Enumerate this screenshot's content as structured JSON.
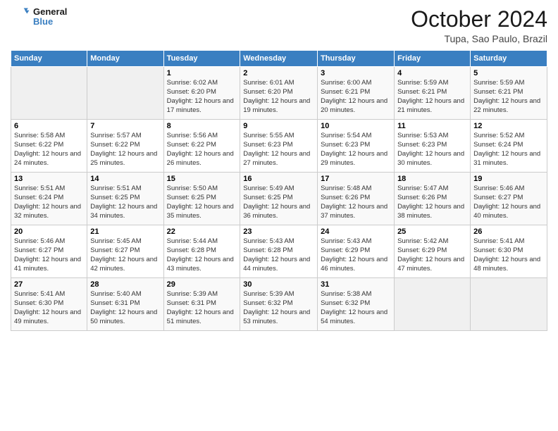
{
  "header": {
    "logo_line1": "General",
    "logo_line2": "Blue",
    "title": "October 2024",
    "subtitle": "Tupa, Sao Paulo, Brazil"
  },
  "days_of_week": [
    "Sunday",
    "Monday",
    "Tuesday",
    "Wednesday",
    "Thursday",
    "Friday",
    "Saturday"
  ],
  "weeks": [
    [
      {
        "num": "",
        "info": ""
      },
      {
        "num": "",
        "info": ""
      },
      {
        "num": "1",
        "info": "Sunrise: 6:02 AM\nSunset: 6:20 PM\nDaylight: 12 hours and 17 minutes."
      },
      {
        "num": "2",
        "info": "Sunrise: 6:01 AM\nSunset: 6:20 PM\nDaylight: 12 hours and 19 minutes."
      },
      {
        "num": "3",
        "info": "Sunrise: 6:00 AM\nSunset: 6:21 PM\nDaylight: 12 hours and 20 minutes."
      },
      {
        "num": "4",
        "info": "Sunrise: 5:59 AM\nSunset: 6:21 PM\nDaylight: 12 hours and 21 minutes."
      },
      {
        "num": "5",
        "info": "Sunrise: 5:59 AM\nSunset: 6:21 PM\nDaylight: 12 hours and 22 minutes."
      }
    ],
    [
      {
        "num": "6",
        "info": "Sunrise: 5:58 AM\nSunset: 6:22 PM\nDaylight: 12 hours and 24 minutes."
      },
      {
        "num": "7",
        "info": "Sunrise: 5:57 AM\nSunset: 6:22 PM\nDaylight: 12 hours and 25 minutes."
      },
      {
        "num": "8",
        "info": "Sunrise: 5:56 AM\nSunset: 6:22 PM\nDaylight: 12 hours and 26 minutes."
      },
      {
        "num": "9",
        "info": "Sunrise: 5:55 AM\nSunset: 6:23 PM\nDaylight: 12 hours and 27 minutes."
      },
      {
        "num": "10",
        "info": "Sunrise: 5:54 AM\nSunset: 6:23 PM\nDaylight: 12 hours and 29 minutes."
      },
      {
        "num": "11",
        "info": "Sunrise: 5:53 AM\nSunset: 6:23 PM\nDaylight: 12 hours and 30 minutes."
      },
      {
        "num": "12",
        "info": "Sunrise: 5:52 AM\nSunset: 6:24 PM\nDaylight: 12 hours and 31 minutes."
      }
    ],
    [
      {
        "num": "13",
        "info": "Sunrise: 5:51 AM\nSunset: 6:24 PM\nDaylight: 12 hours and 32 minutes."
      },
      {
        "num": "14",
        "info": "Sunrise: 5:51 AM\nSunset: 6:25 PM\nDaylight: 12 hours and 34 minutes."
      },
      {
        "num": "15",
        "info": "Sunrise: 5:50 AM\nSunset: 6:25 PM\nDaylight: 12 hours and 35 minutes."
      },
      {
        "num": "16",
        "info": "Sunrise: 5:49 AM\nSunset: 6:25 PM\nDaylight: 12 hours and 36 minutes."
      },
      {
        "num": "17",
        "info": "Sunrise: 5:48 AM\nSunset: 6:26 PM\nDaylight: 12 hours and 37 minutes."
      },
      {
        "num": "18",
        "info": "Sunrise: 5:47 AM\nSunset: 6:26 PM\nDaylight: 12 hours and 38 minutes."
      },
      {
        "num": "19",
        "info": "Sunrise: 5:46 AM\nSunset: 6:27 PM\nDaylight: 12 hours and 40 minutes."
      }
    ],
    [
      {
        "num": "20",
        "info": "Sunrise: 5:46 AM\nSunset: 6:27 PM\nDaylight: 12 hours and 41 minutes."
      },
      {
        "num": "21",
        "info": "Sunrise: 5:45 AM\nSunset: 6:27 PM\nDaylight: 12 hours and 42 minutes."
      },
      {
        "num": "22",
        "info": "Sunrise: 5:44 AM\nSunset: 6:28 PM\nDaylight: 12 hours and 43 minutes."
      },
      {
        "num": "23",
        "info": "Sunrise: 5:43 AM\nSunset: 6:28 PM\nDaylight: 12 hours and 44 minutes."
      },
      {
        "num": "24",
        "info": "Sunrise: 5:43 AM\nSunset: 6:29 PM\nDaylight: 12 hours and 46 minutes."
      },
      {
        "num": "25",
        "info": "Sunrise: 5:42 AM\nSunset: 6:29 PM\nDaylight: 12 hours and 47 minutes."
      },
      {
        "num": "26",
        "info": "Sunrise: 5:41 AM\nSunset: 6:30 PM\nDaylight: 12 hours and 48 minutes."
      }
    ],
    [
      {
        "num": "27",
        "info": "Sunrise: 5:41 AM\nSunset: 6:30 PM\nDaylight: 12 hours and 49 minutes."
      },
      {
        "num": "28",
        "info": "Sunrise: 5:40 AM\nSunset: 6:31 PM\nDaylight: 12 hours and 50 minutes."
      },
      {
        "num": "29",
        "info": "Sunrise: 5:39 AM\nSunset: 6:31 PM\nDaylight: 12 hours and 51 minutes."
      },
      {
        "num": "30",
        "info": "Sunrise: 5:39 AM\nSunset: 6:32 PM\nDaylight: 12 hours and 53 minutes."
      },
      {
        "num": "31",
        "info": "Sunrise: 5:38 AM\nSunset: 6:32 PM\nDaylight: 12 hours and 54 minutes."
      },
      {
        "num": "",
        "info": ""
      },
      {
        "num": "",
        "info": ""
      }
    ]
  ]
}
